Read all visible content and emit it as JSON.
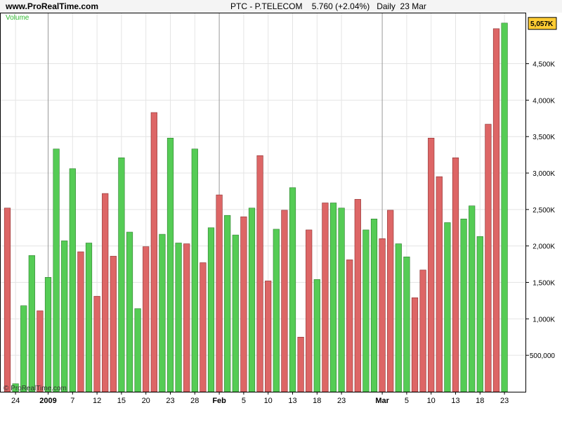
{
  "header": {
    "site": "www.ProRealTime.com",
    "title": "PTC - P.TELECOM    5.760 (+2.04%)   Daily  23 Mar"
  },
  "panel_label": "Volume",
  "copyright": "© ProRealTime.com",
  "colors": {
    "up": "#55cc55",
    "down": "#dd6666",
    "marker": "#ffcc33"
  },
  "chart_data": {
    "type": "bar",
    "title": "Volume",
    "ylim": [
      0,
      5200000
    ],
    "y_ticks": [
      500000,
      1000000,
      1500000,
      2000000,
      2500000,
      3000000,
      3500000,
      4000000,
      4500000
    ],
    "y_tick_labels": [
      "500,000",
      "1,000K",
      "1,500K",
      "2,000K",
      "2,500K",
      "3,000K",
      "3,500K",
      "4,000K",
      "4,500K"
    ],
    "last_value_label": "5,057K",
    "last_value": 5057000,
    "values": [
      2520000,
      110000,
      1180000,
      1870000,
      1110000,
      1570000,
      3330000,
      2070000,
      3060000,
      1920000,
      2040000,
      1310000,
      2720000,
      1860000,
      3210000,
      2190000,
      1140000,
      1990000,
      3830000,
      2160000,
      3480000,
      2040000,
      2030000,
      3330000,
      1770000,
      2250000,
      2700000,
      2420000,
      2150000,
      2400000,
      2520000,
      3240000,
      1520000,
      2230000,
      2490000,
      2800000,
      750000,
      2220000,
      1540000,
      2590000,
      2590000,
      2520000,
      1810000,
      2640000,
      2220000,
      2370000,
      2100000,
      2490000,
      2030000,
      1850000,
      1290000,
      1670000,
      3480000,
      2950000,
      2320000,
      3210000,
      2370000,
      2550000,
      2130000,
      3670000,
      4980000,
      5057000
    ],
    "directions": [
      "down",
      "up",
      "up",
      "up",
      "down",
      "up",
      "up",
      "up",
      "up",
      "down",
      "up",
      "down",
      "down",
      "down",
      "up",
      "up",
      "up",
      "down",
      "down",
      "up",
      "up",
      "up",
      "down",
      "up",
      "down",
      "up",
      "down",
      "up",
      "up",
      "down",
      "up",
      "down",
      "down",
      "up",
      "down",
      "up",
      "down",
      "down",
      "up",
      "down",
      "up",
      "up",
      "down",
      "down",
      "up",
      "up",
      "down",
      "down",
      "up",
      "up",
      "down",
      "down",
      "down",
      "down",
      "up",
      "down",
      "up",
      "up",
      "up",
      "down",
      "down",
      "up"
    ],
    "x_labels": [
      {
        "index": 1,
        "text": "24",
        "bold": false
      },
      {
        "index": 5,
        "text": "2009",
        "bold": true
      },
      {
        "index": 8,
        "text": "7",
        "bold": false
      },
      {
        "index": 11,
        "text": "12",
        "bold": false
      },
      {
        "index": 14,
        "text": "15",
        "bold": false
      },
      {
        "index": 17,
        "text": "20",
        "bold": false
      },
      {
        "index": 20,
        "text": "23",
        "bold": false
      },
      {
        "index": 23,
        "text": "28",
        "bold": false
      },
      {
        "index": 26,
        "text": "Feb",
        "bold": true
      },
      {
        "index": 29,
        "text": "5",
        "bold": false
      },
      {
        "index": 32,
        "text": "10",
        "bold": false
      },
      {
        "index": 35,
        "text": "13",
        "bold": false
      },
      {
        "index": 38,
        "text": "18",
        "bold": false
      },
      {
        "index": 41,
        "text": "23",
        "bold": false
      },
      {
        "index": 46,
        "text": "Mar",
        "bold": true
      },
      {
        "index": 49,
        "text": "5",
        "bold": false
      },
      {
        "index": 52,
        "text": "10",
        "bold": false
      },
      {
        "index": 55,
        "text": "13",
        "bold": false
      },
      {
        "index": 58,
        "text": "18",
        "bold": false
      },
      {
        "index": 61,
        "text": "23",
        "bold": false
      }
    ],
    "period_separators": [
      5,
      26,
      46
    ],
    "grid": true
  }
}
